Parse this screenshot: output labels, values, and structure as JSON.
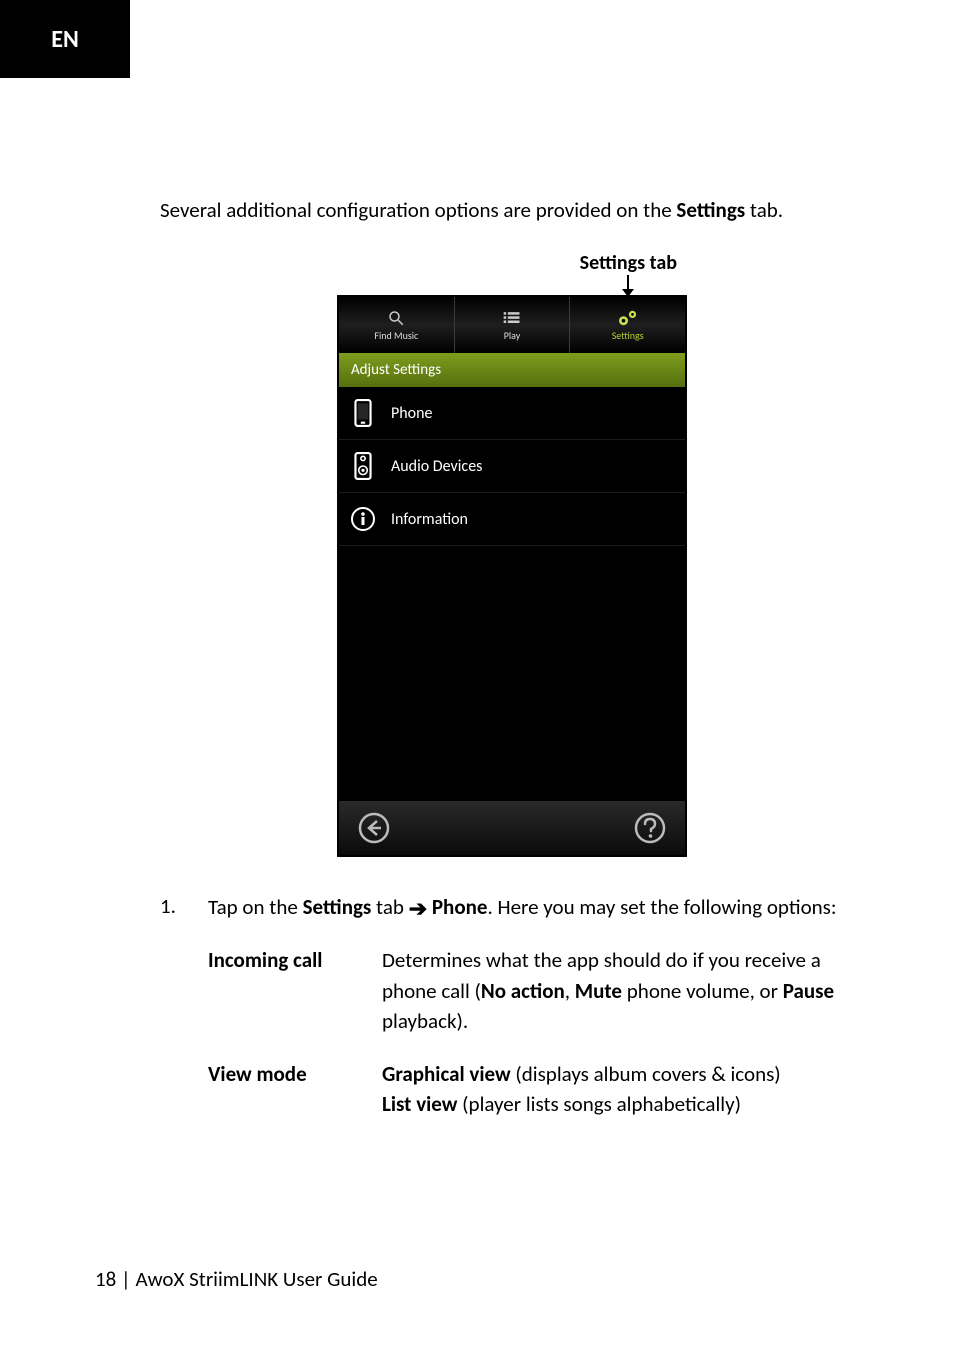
{
  "lang_tab": "EN",
  "intro_pre": "Several additional configuration options are provided on the ",
  "intro_bold": "Settings",
  "intro_post": " tab.",
  "callout": "Settings tab",
  "phone": {
    "tabs": {
      "find_music": "Find Music",
      "play": "Play",
      "settings": "Settings"
    },
    "section": "Adjust Settings",
    "rows": {
      "phone": "Phone",
      "audio": "Audio Devices",
      "info": "Information"
    }
  },
  "step": {
    "marker": "1.",
    "t1": "Tap on the ",
    "b1": "Settings",
    "t2": " tab ",
    "b2": "Phone",
    "t3": ". Here you may set the following options:"
  },
  "opts": {
    "row1": {
      "key": "Incoming call",
      "v1": "Determines what the app should do if you receive a  phone call (",
      "b1": "No action",
      "v2": ", ",
      "b2": "Mute",
      "v3": " phone volume, or ",
      "b3": "Pause",
      "v4": " playback)."
    },
    "row2": {
      "key": "View mode",
      "b1": "Graphical view",
      "v1": " (displays album covers & icons)",
      "b2": "List view",
      "v2": " (player lists songs alphabetically)"
    }
  },
  "footer": {
    "pagenum": "18",
    "sep": " | ",
    "title": "AwoX StriimLINK  User Guide"
  }
}
